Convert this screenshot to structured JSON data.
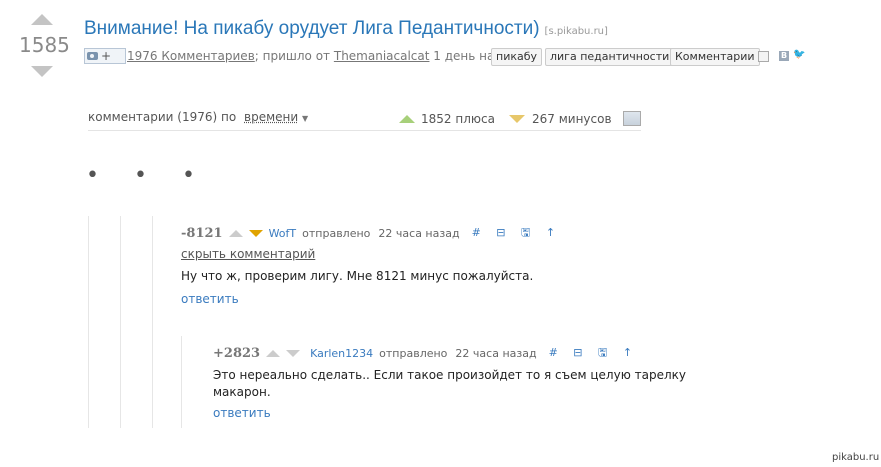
{
  "post": {
    "rating": "1585",
    "title": "Внимание! На пикабу орудует Лига Педантичности)",
    "domain": "[s.pikabu.ru]",
    "photo_plus": "+",
    "comments_link": "1976 Комментариев",
    "meta_sep": "; пришло от",
    "author": "Themaniacalcat",
    "time": "1 день назад",
    "tags": [
      "пикабу",
      "лига педантичности",
      "Комментарии"
    ],
    "vk_label": "B",
    "twitter_glyph": "🐦"
  },
  "sort": {
    "label": "комментарии (1976) по",
    "value": "времени",
    "pluses": "1852 плюса",
    "minuses": "267 минусов"
  },
  "dots": "• • •",
  "comments": [
    {
      "rating": "-8121",
      "user": "WofT",
      "sent": "отправлено",
      "time": "22 часа назад",
      "icons": "# ⊟ 🖫 ↑",
      "hide": "скрыть комментарий",
      "text": "Ну что ж, проверим лигу. Мне 8121 минус пожалуйста.",
      "reply": "ответить"
    },
    {
      "rating": "+2823",
      "user": "Karlen1234",
      "sent": "отправлено",
      "time": "22 часа назад",
      "icons": "# ⊟ 🖫 ↑",
      "text_line1": "Это нереально сделать.. Если такое произойдет то я съем целую тарелку",
      "text_line2": "макарон.",
      "reply": "ответить"
    }
  ],
  "watermark": "pikabu.ru",
  "colors": {
    "link": "#2a77b8",
    "plus": "#a7d07a",
    "minus": "#e7c76a",
    "active_minus": "#e0a300"
  }
}
